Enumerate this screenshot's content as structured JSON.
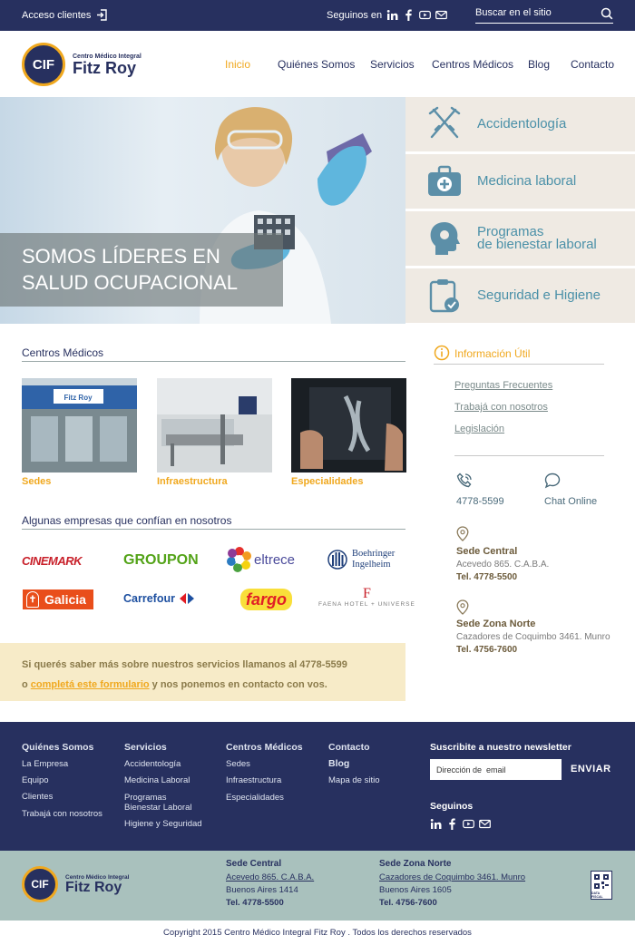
{
  "topbar": {
    "login": "Acceso clientes",
    "follow": "Seguinos en",
    "search_placeholder": "Buscar en el sitio"
  },
  "logo": {
    "small": "Centro Médico Integral",
    "big": "Fitz Roy",
    "mark": "CIF"
  },
  "nav": [
    "Inicio",
    "Quiénes Somos",
    "Servicios",
    "Centros Médicos",
    "Blog",
    "Contacto"
  ],
  "hero": {
    "line1": "SOMOS LÍDERES EN",
    "line2": "SALUD OCUPACIONAL"
  },
  "services": [
    {
      "label1": "Accidentología",
      "label2": "",
      "icon": "crutches-icon"
    },
    {
      "label1": "Medicina laboral",
      "label2": "",
      "icon": "medical-kit-icon"
    },
    {
      "label1": "Programas",
      "label2": "de bienestar laboral",
      "icon": "head-icon"
    },
    {
      "label1": "Seguridad e Higiene",
      "label2": "",
      "icon": "clipboard-check-icon"
    }
  ],
  "centros": {
    "title": "Centros Médicos",
    "items": [
      "Sedes",
      "Infraestructura",
      "Especialidades"
    ]
  },
  "empresas": {
    "title": "Algunas empresas que confían en nosotros",
    "brands": [
      "CINEMARK",
      "GROUPON",
      "eltrece",
      "Boehringer",
      "Ingelheim",
      "Galicia",
      "Carrefour",
      "fargo",
      "FAENA HOTEL + UNIVERSE"
    ]
  },
  "info": {
    "title": "Información Útil",
    "links": [
      "Preguntas Frecuentes",
      "Trabajá con nosotros",
      "Legislación"
    ],
    "phone": "4778-5599",
    "chat": "Chat Online",
    "sede_central": {
      "title": "Sede Central",
      "address": "Acevedo 865. C.A.B.A.",
      "phone": "Tel. 4778-5500"
    },
    "sede_norte": {
      "title": "Sede Zona Norte",
      "address": "Cazadores de Coquimbo 3461. Munro",
      "phone": "Tel. 4756-7600"
    }
  },
  "cta": {
    "text1": "Si querés saber más sobre nuestros servicios llamanos al 4778-5599",
    "text2a": "o ",
    "link": "completá este formulario",
    "text2b": " y nos ponemos en contacto con vos."
  },
  "footer": {
    "cols": [
      {
        "title": "Quiénes Somos",
        "items": [
          "La Empresa",
          "Equipo",
          "Clientes",
          "Trabajá con nosotros"
        ]
      },
      {
        "title": "Servicios",
        "items": [
          "Accidentología",
          "Medicina Laboral",
          "Programas\nBienestar Laboral",
          "Higiene y Seguridad"
        ]
      },
      {
        "title": "Centros Médicos",
        "items": [
          "Sedes",
          "Infraestructura",
          "Especialidades"
        ]
      },
      {
        "title": "Contacto",
        "items": [
          "Blog",
          "Mapa de sitio"
        ]
      }
    ],
    "newsletter_title": "Suscribite a nuestro newsletter",
    "newsletter_placeholder": "Dirección de  email",
    "send": "ENVIAR",
    "follow": "Seguinos"
  },
  "footer2": {
    "central": {
      "title": "Sede Central",
      "address": "Acevedo 865. C.A.B.A.",
      "city": "Buenos Aires 1414",
      "phone": "Tel. 4778-5500"
    },
    "norte": {
      "title": "Sede Zona Norte",
      "address": "Cazadores de Coquimbo 3461. Munro",
      "city": "Buenos Aires 1605",
      "phone": "Tel. 4756-7600"
    },
    "fiscal": "DATA FISCAL"
  },
  "copyright": "Copyright 2015 Centro Médico Integral Fitz Roy . Todos los derechos reservados",
  "colors": {
    "navy": "#27305f",
    "orange": "#f0a81e",
    "teal": "#4a90a8",
    "beige": "#efeae3",
    "sage": "#a9c1bd"
  }
}
